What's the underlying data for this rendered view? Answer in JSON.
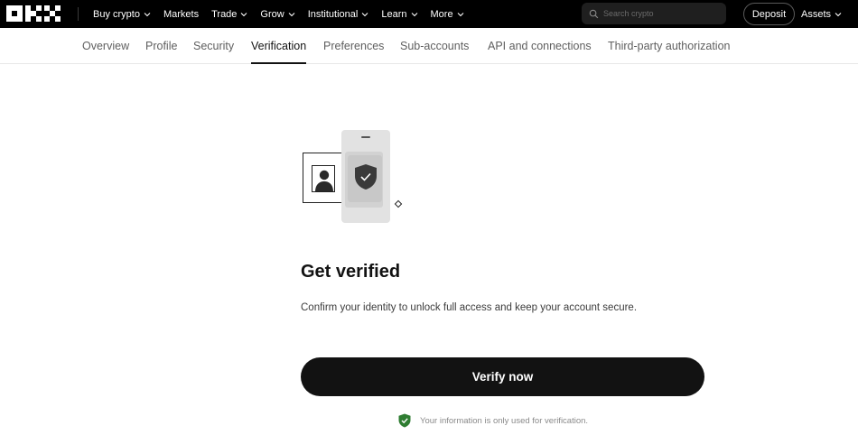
{
  "brand": {
    "logo_text": "OKX"
  },
  "topnav": {
    "items": [
      {
        "label": "Buy crypto",
        "has_dropdown": true
      },
      {
        "label": "Markets",
        "has_dropdown": false
      },
      {
        "label": "Trade",
        "has_dropdown": true
      },
      {
        "label": "Grow",
        "has_dropdown": true
      },
      {
        "label": "Institutional",
        "has_dropdown": true
      },
      {
        "label": "Learn",
        "has_dropdown": true
      },
      {
        "label": "More",
        "has_dropdown": true
      }
    ],
    "search_placeholder": "Search crypto",
    "deposit_label": "Deposit",
    "assets_label": "Assets"
  },
  "subtabs": {
    "items": [
      {
        "label": "Overview"
      },
      {
        "label": "Profile"
      },
      {
        "label": "Security"
      },
      {
        "label": "Verification"
      },
      {
        "label": "Preferences"
      },
      {
        "label": "Sub-accounts"
      },
      {
        "label": "API and connections"
      },
      {
        "label": "Third-party authorization"
      }
    ],
    "active": "Verification"
  },
  "main": {
    "title": "Get verified",
    "description": "Confirm your identity to unlock full access and keep your account secure.",
    "verify_button": "Verify now",
    "note": "Your information is only used for verification."
  },
  "colors": {
    "topbar_bg": "#000000",
    "button_bg": "#121212",
    "shield_green": "#2f7d32",
    "text_primary": "#121212"
  },
  "icons": [
    "okx-logo",
    "chevron-down-icon",
    "search-icon",
    "id-card-icon",
    "shield-check-icon",
    "diamond-icon",
    "shield-check-green-icon"
  ]
}
